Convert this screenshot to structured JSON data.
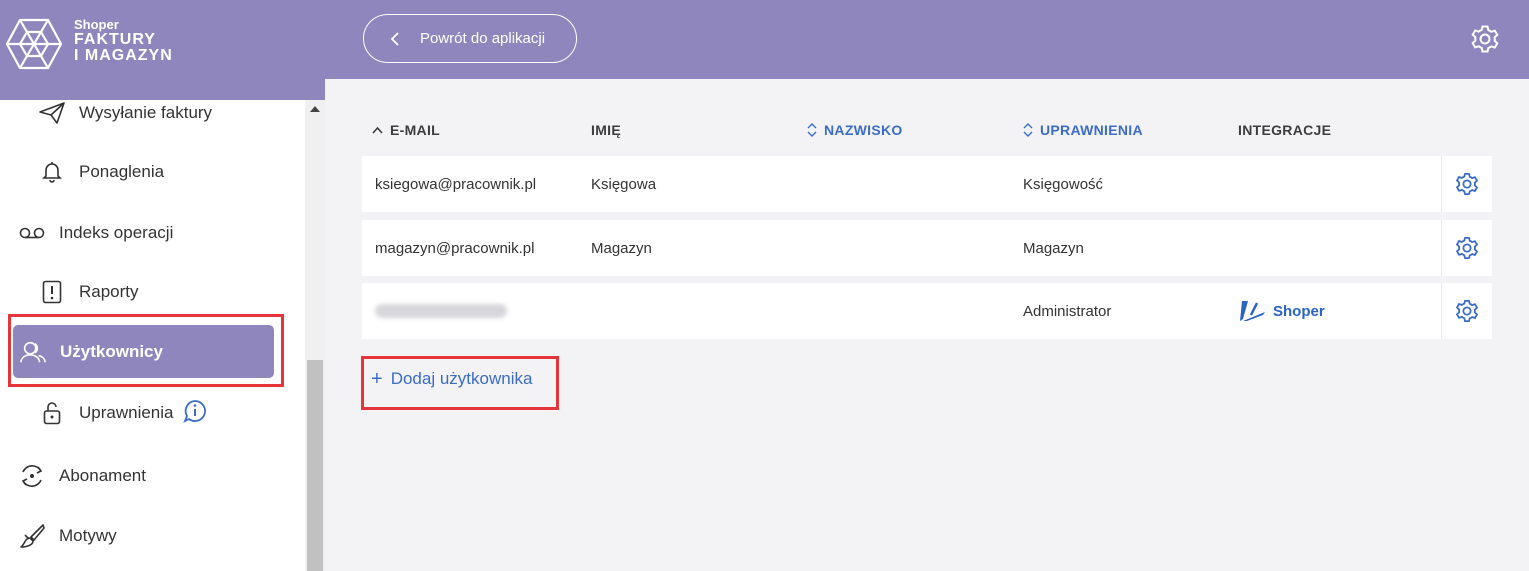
{
  "brand": {
    "small": "Shoper",
    "line1": "FAKTURY",
    "line2": "I MAGAZYN"
  },
  "sidebar": {
    "items": [
      {
        "label": "Wysyłanie faktury",
        "icon": "paper-plane-icon"
      },
      {
        "label": "Ponaglenia",
        "icon": "bell-icon"
      },
      {
        "label": "Indeks operacji",
        "icon": "voicemail-icon"
      },
      {
        "label": "Raporty",
        "icon": "report-alert-icon"
      },
      {
        "label": "Użytkownicy",
        "icon": "users-icon",
        "active": true
      },
      {
        "label": "Uprawnienia",
        "icon": "lock-icon"
      },
      {
        "label": "Abonament",
        "icon": "refresh-cycle-icon"
      },
      {
        "label": "Motywy",
        "icon": "brush-icon"
      }
    ]
  },
  "header": {
    "back_label": "Powrót do aplikacji"
  },
  "table": {
    "columns": [
      "E-MAIL",
      "IMIĘ",
      "NAZWISKO",
      "UPRAWNIENIA",
      "INTEGRACJE"
    ],
    "rows": [
      {
        "email": "ksiegowa@pracownik.pl",
        "first_name": "Księgowa",
        "last_name": "",
        "role": "Księgowość",
        "integration": ""
      },
      {
        "email": "magazyn@pracownik.pl",
        "first_name": "Magazyn",
        "last_name": "",
        "role": "Magazyn",
        "integration": ""
      },
      {
        "email": "",
        "first_name": "",
        "last_name": "",
        "role": "Administrator",
        "integration": "Shoper"
      }
    ]
  },
  "add_user_label": "Dodaj użytkownika",
  "colors": {
    "accent": "#8e86bd",
    "link": "#3b6cc9",
    "highlight": "#e5353b"
  }
}
